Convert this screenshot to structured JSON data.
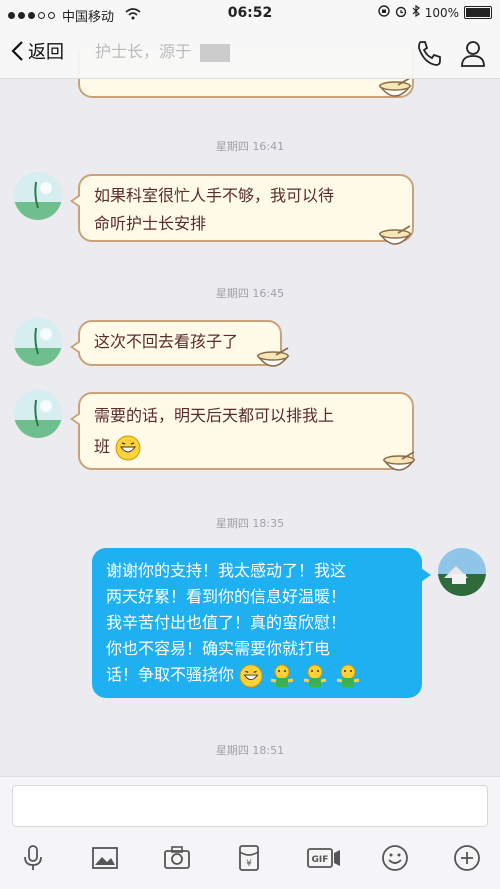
{
  "status_bar": {
    "carrier": "中国移动",
    "time": "06:52",
    "battery": "100%"
  },
  "nav": {
    "back_label": "返回",
    "title_text": "护士长，源于"
  },
  "timestamps": [
    "星期四 16:41",
    "星期四 16:45",
    "星期四 18:35",
    "星期四 18:51"
  ],
  "messages": {
    "m1": {
      "line1": "如果科室很忙人手不够，我可以待",
      "line2": "命听护士长安排"
    },
    "m2": {
      "line1": "这次不回去看孩子了"
    },
    "m3": {
      "line1": "需要的话，明天后天都可以排我上",
      "line2": "班"
    },
    "m4": {
      "line1": "谢谢你的支持！我太感动了！我这",
      "line2": "两天好累！看到你的信息好温暖！",
      "line3": "我辛苦付出也值了！真的蛮欣慰！",
      "line4": "你也不容易！确实需要你就打电",
      "line5": "话！争取不骚挠你"
    }
  },
  "input": {
    "placeholder": ""
  },
  "colors": {
    "outgoing": "#1fb0f2",
    "incoming_bg": "#fffbe8",
    "incoming_border": "#caa27a",
    "incoming_text": "#5a2c2c"
  }
}
